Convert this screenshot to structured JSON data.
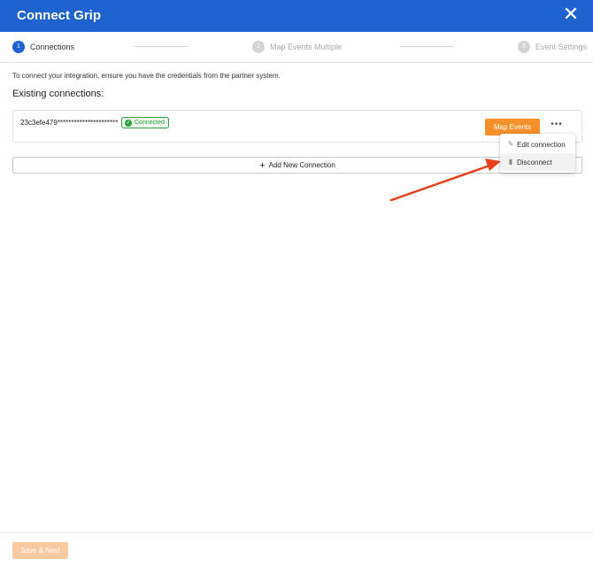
{
  "header": {
    "title": "Connect Grip",
    "close_icon": "close-icon"
  },
  "steps": [
    {
      "number": "1",
      "label": "Connections",
      "state": "active"
    },
    {
      "number": "2",
      "label": "Map Events Multiple",
      "state": "inactive"
    },
    {
      "number": "3",
      "label": "Event Settings",
      "state": "inactive"
    }
  ],
  "main": {
    "info_text": "To connect your integration, ensure you have the credentials from the partner system.",
    "section_title": "Existing connections:",
    "connection": {
      "id": "23c3efe479**********************",
      "status": "Connected",
      "map_button": "Map Events",
      "more_button": "•••"
    },
    "add_button": {
      "icon": "+",
      "label": "Add New Connection"
    },
    "dropdown": {
      "items": [
        {
          "icon": "✎",
          "label": "Edit connection"
        },
        {
          "icon": "▮",
          "label": "Disconnect"
        }
      ]
    }
  },
  "footer": {
    "save_label": "Save & Next"
  },
  "colors": {
    "header_bg": "#1e62d0",
    "accent_orange": "#f5902a",
    "success_green": "#2e9e3f",
    "annotation_red": "#e8401c"
  }
}
